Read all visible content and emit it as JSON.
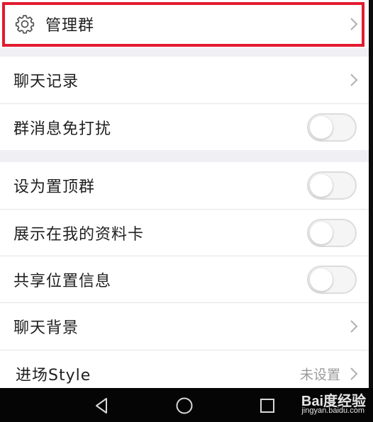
{
  "settings": {
    "manage_group": {
      "label": "管理群",
      "icon": "gear-icon"
    },
    "chat_history": {
      "label": "聊天记录"
    },
    "mute_notifications": {
      "label": "群消息免打扰",
      "enabled": false
    },
    "pin_to_top": {
      "label": "设为置顶群",
      "enabled": false
    },
    "show_on_profile": {
      "label": "展示在我的资料卡",
      "enabled": false
    },
    "share_location": {
      "label": "共享位置信息",
      "enabled": false
    },
    "chat_background": {
      "label": "聊天背景"
    },
    "entrance_style": {
      "label": "进场Style",
      "value": "未设置"
    }
  },
  "watermark": {
    "logo": "Bai度经验",
    "url": "jingyan.baidu.com"
  },
  "colors": {
    "highlight": "#e21b2f",
    "background": "#efeff4",
    "row": "#ffffff"
  }
}
